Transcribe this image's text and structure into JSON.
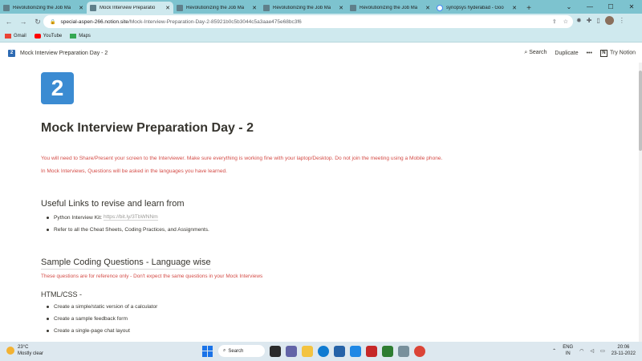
{
  "browser": {
    "tabs": [
      {
        "title": "Revolutionizing the Job Ma",
        "active": false
      },
      {
        "title": "Mock Interview Preparatio",
        "active": true
      },
      {
        "title": "Revolutionizing the Job Ma",
        "active": false
      },
      {
        "title": "Revolutionizing the Job Ma",
        "active": false
      },
      {
        "title": "Revolutionizing the Job Ma",
        "active": false
      },
      {
        "title": "synopsys hyderabad - Goo",
        "active": false
      }
    ],
    "new_tab_label": "+",
    "address": {
      "host": "special-aspen-266.notion.site",
      "path": "/Mock-Interview-Preparation-Day-2-85921b0c5b3044c5a3aae475e68bc3f6"
    },
    "bookmarks": [
      "Gmail",
      "YouTube",
      "Maps"
    ]
  },
  "notion": {
    "breadcrumb_icon": "2",
    "breadcrumb": "Mock Interview Preparation Day - 2",
    "actions": {
      "search": "Search",
      "duplicate": "Duplicate",
      "more": "•••",
      "try_notion": "Try Notion"
    }
  },
  "page": {
    "icon_text": "2",
    "title": "Mock Interview Preparation Day - 2",
    "warnings": [
      "You will need to Share/Present your screen to the Interviewer. Make sure everything is working fine with your laptop/Desktop. Do not join the meeting using a Mobile phone.",
      "In Mock Interviews, Questions will be asked in the languages you have learned."
    ],
    "useful_links": {
      "heading": "Useful Links to revise and learn from",
      "items": [
        {
          "label": "Python Interview Kit: ",
          "link": "https://bit.ly/3TbWNNm"
        },
        {
          "label": "Refer to all the Cheat Sheets, Coding Practices, and Assignments.",
          "link": ""
        }
      ]
    },
    "sample": {
      "heading": "Sample Coding Questions - Language wise",
      "note": "These questions are for reference only - Don't expect the same questions in your Mock Interviews",
      "html_css": {
        "heading": "HTML/CSS -",
        "items": [
          "Create a simple/static version of a calculator",
          "Create a sample feedback form",
          "Create a single-page chat layout"
        ]
      }
    }
  },
  "taskbar": {
    "temp": "23°C",
    "weather": "Mostly clear",
    "search": "Search",
    "lang_top": "ENG",
    "lang_bottom": "IN",
    "time": "20:06",
    "date": "23-11-2022"
  }
}
